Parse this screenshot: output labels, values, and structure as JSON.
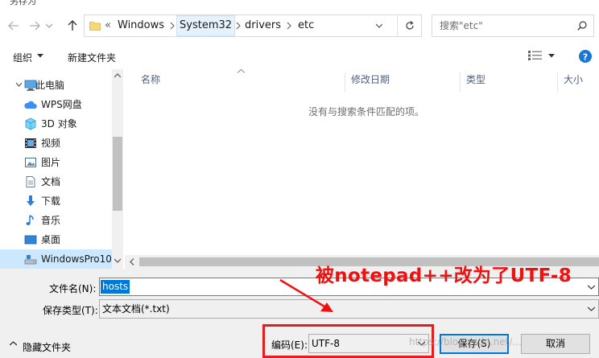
{
  "window": {
    "title": "另存为"
  },
  "address": {
    "crumbs": [
      "Windows",
      "System32",
      "drivers",
      "etc"
    ],
    "overflow_glyph": "«"
  },
  "search": {
    "placeholder": "搜索\"etc\""
  },
  "toolbar": {
    "organize": "组织",
    "new_folder": "新建文件夹"
  },
  "sidebar": {
    "items": [
      {
        "label": "此电脑",
        "icon": "computer-icon"
      },
      {
        "label": "WPS网盘",
        "icon": "cloud-icon"
      },
      {
        "label": "3D 对象",
        "icon": "cube-icon"
      },
      {
        "label": "视频",
        "icon": "video-icon"
      },
      {
        "label": "图片",
        "icon": "picture-icon"
      },
      {
        "label": "文档",
        "icon": "document-icon"
      },
      {
        "label": "下载",
        "icon": "download-icon"
      },
      {
        "label": "音乐",
        "icon": "music-icon"
      },
      {
        "label": "桌面",
        "icon": "desktop-icon"
      },
      {
        "label": "WindowsPro10",
        "icon": "drive-icon"
      }
    ]
  },
  "list": {
    "columns": [
      "名称",
      "修改日期",
      "类型",
      "大小"
    ],
    "empty_message": "没有与搜索条件匹配的项。"
  },
  "form": {
    "filename_label": "文件名(N):",
    "filename_value": "hosts",
    "filetype_label": "保存类型(T):",
    "filetype_value": "文本文档(*.txt)",
    "encoding_label": "编码(E):",
    "encoding_value": "UTF-8"
  },
  "buttons": {
    "hide_folders": "隐藏文件夹",
    "save": "保存(S)",
    "cancel": "取消"
  },
  "annotation": {
    "text": "被notepad++改为了UTF-8",
    "color": "#f01010"
  },
  "watermark": "https://blog.csdn.net/..."
}
